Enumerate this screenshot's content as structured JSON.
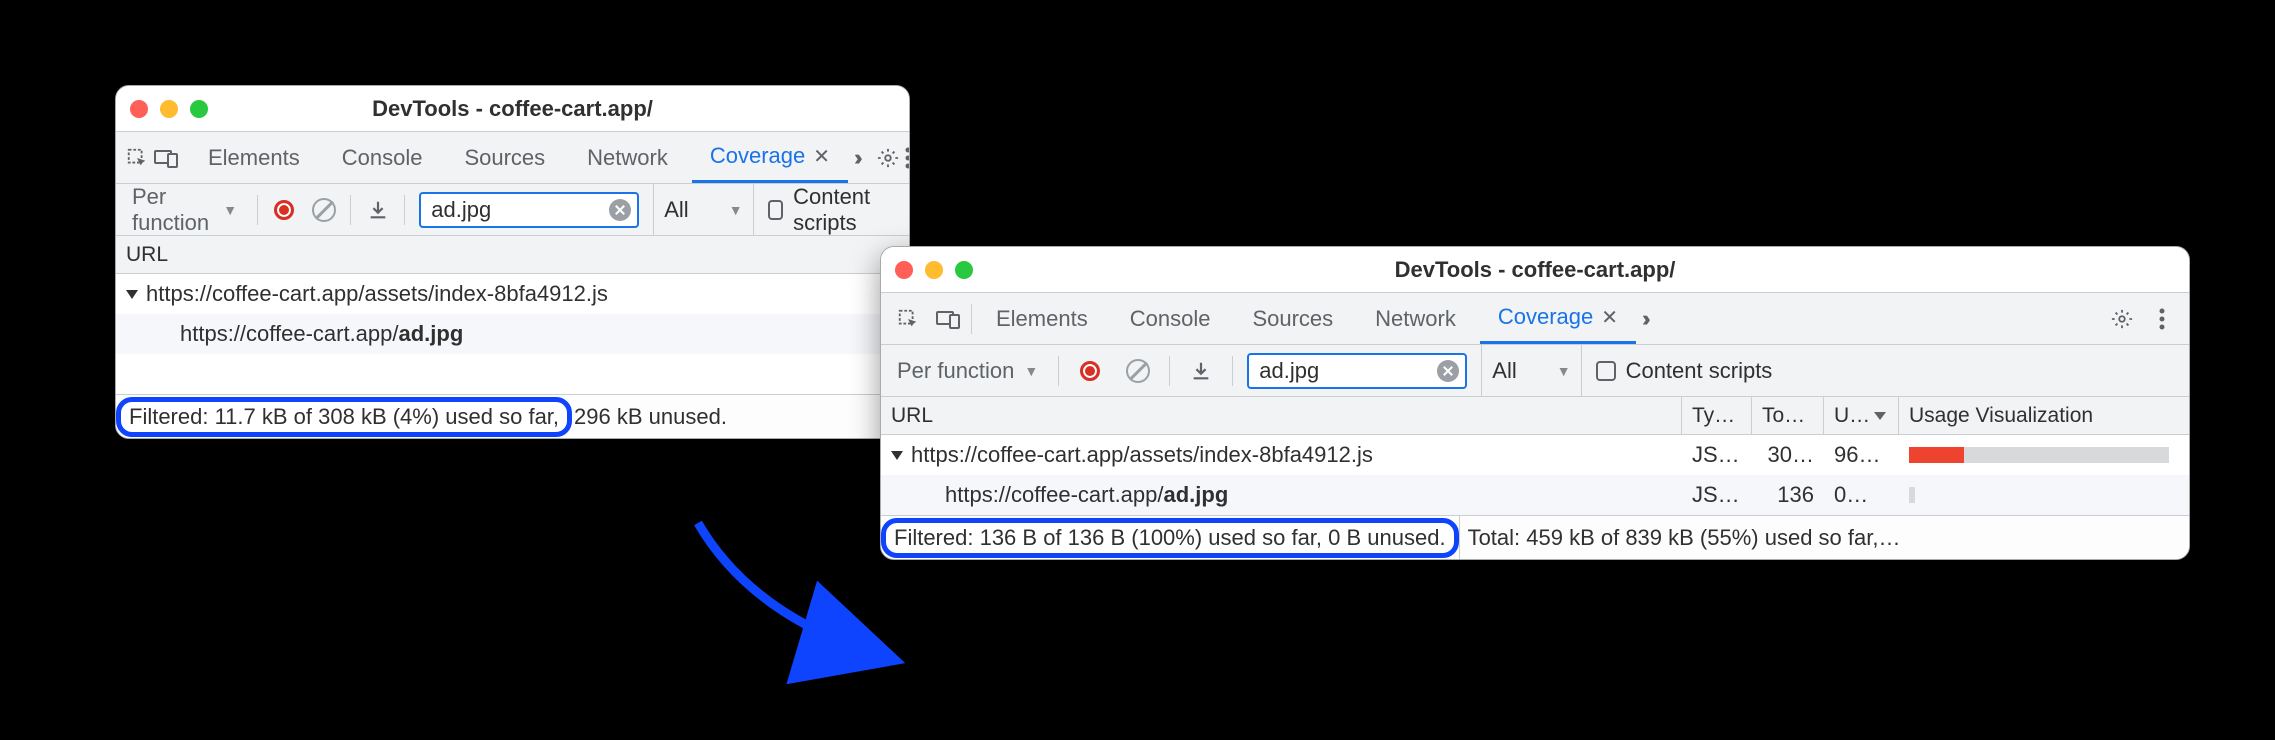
{
  "titlebar": {
    "title": "DevTools - coffee-cart.app/"
  },
  "tabs": {
    "elements": "Elements",
    "console": "Console",
    "sources": "Sources",
    "network": "Network",
    "coverage": "Coverage"
  },
  "toolbar": {
    "mode": "Per function",
    "filter_value": "ad.jpg",
    "type_filter": "All",
    "content_scripts": "Content scripts"
  },
  "columns": {
    "url": "URL",
    "type": "Ty…",
    "total": "To…",
    "unused": "U…",
    "viz": "Usage Visualization"
  },
  "windowA": {
    "rows": [
      {
        "url_pre": "https://coffee-cart.app/assets/index-8bfa4912.js",
        "url_bold": "",
        "twisty": true
      },
      {
        "url_pre": "https://coffee-cart.app/",
        "url_bold": "ad.jpg",
        "twisty": false
      }
    ],
    "status": {
      "filtered": "Filtered: 11.7 kB of 308 kB (4%) used so far,",
      "rest": "296 kB unused."
    }
  },
  "windowB": {
    "rows": [
      {
        "url_pre": "https://coffee-cart.app/assets/index-8bfa4912.js",
        "url_bold": "",
        "twisty": true,
        "type": "JS…",
        "total": "30…",
        "unused": "96…",
        "used_pct": 5
      },
      {
        "url_pre": "https://coffee-cart.app/",
        "url_bold": "ad.jpg",
        "twisty": false,
        "type": "JS…",
        "total": "136",
        "unused": "0…",
        "used_pct": 1
      }
    ],
    "status": {
      "filtered": "Filtered: 136 B of 136 B (100%) used so far, 0 B unused.",
      "total": "Total: 459 kB of 839 kB (55%) used so far,…"
    }
  }
}
